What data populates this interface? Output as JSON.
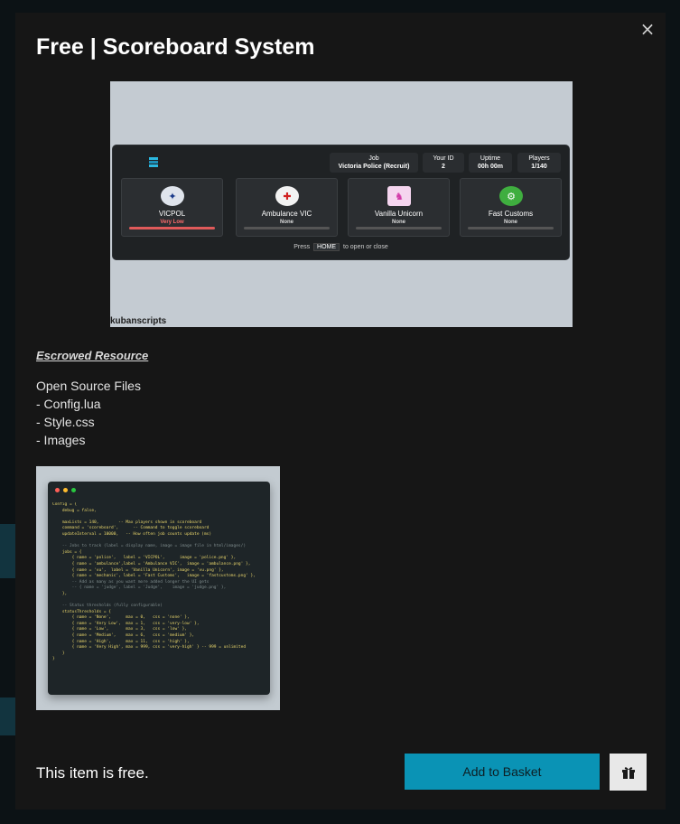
{
  "modal": {
    "title": "Free | Scoreboard System",
    "close_glyph": "×",
    "escrow_label": "Escrowed Resource",
    "description_lines": [
      "Open Source Files",
      "- Config.lua",
      "- Style.css",
      "- Images"
    ],
    "footer_text": "This item is free.",
    "add_to_basket_label": "Add to Basket",
    "gift_icon": "gift-icon"
  },
  "hero_image": {
    "watermark": "kubanscripts",
    "stats": [
      {
        "label": "Job",
        "value": "Victoria Police (Recruit)"
      },
      {
        "label": "Your ID",
        "value": "2"
      },
      {
        "label": "Uptime",
        "value": "00h 00m"
      },
      {
        "label": "Players",
        "value": "1/140"
      }
    ],
    "cards": [
      {
        "name": "VICPOL",
        "status": "Very Low",
        "status_color": "#ff6b6b",
        "bar_color": "#e05a5a",
        "icon": "police-badge-icon"
      },
      {
        "name": "Ambulance VIC",
        "status": "None",
        "status_color": "#dddddd",
        "bar_color": "#555555",
        "icon": "ambulance-cross-icon"
      },
      {
        "name": "Vanilla Unicorn",
        "status": "None",
        "status_color": "#dddddd",
        "bar_color": "#555555",
        "icon": "unicorn-icon"
      },
      {
        "name": "Fast Customs",
        "status": "None",
        "status_color": "#dddddd",
        "bar_color": "#555555",
        "icon": "fast-customs-icon"
      }
    ],
    "hint_pre": "Press",
    "hint_key": "HOME",
    "hint_post": "to open or close"
  },
  "code_image": {
    "lines": [
      "Config = {",
      "    debug = false,",
      "",
      "    maxLists = 140,        -- Max players shown in scoreboard",
      "    command = 'scoreboard',      -- Command to toggle scoreboard",
      "    updateInterval = 10000,   -- How often job counts update (ms)",
      "",
      "    -- Jobs to track (label = display name, image = image file in html/images/)",
      "    jobs = {",
      "        { name = 'police',   label = 'VICPOL',      image = 'police.png' },",
      "        { name = 'ambulance',label = 'Ambulance VIC',  image = 'ambulance.png' },",
      "        { name = 'vu',  label = 'Vanilla Unicorn', image = 'vu.png' },",
      "        { name = 'mechanic', label = 'Fast Customs',   image = 'fastcustoms.png' },",
      "        -- Add as many as you want more added longer the UI gets",
      "        -- { name = 'judge', label = 'Judge',    image = 'judge.png' },",
      "    },",
      "",
      "    -- Status thresholds (fully configurable)",
      "    statusThresholds = {",
      "        { name = 'None',      max = 0,   css = 'none' },",
      "        { name = 'Very Low',  max = 1,   css = 'very-low' },",
      "        { name = 'Low',       max = 3,   css = 'low' },",
      "        { name = 'Medium',    max = 6,   css = 'medium' },",
      "        { name = 'High',      max = 11,  css = 'high' },",
      "        { name = 'Very High', max = 999, css = 'very-high' } -- 999 = unlimited",
      "    }",
      "}"
    ]
  }
}
